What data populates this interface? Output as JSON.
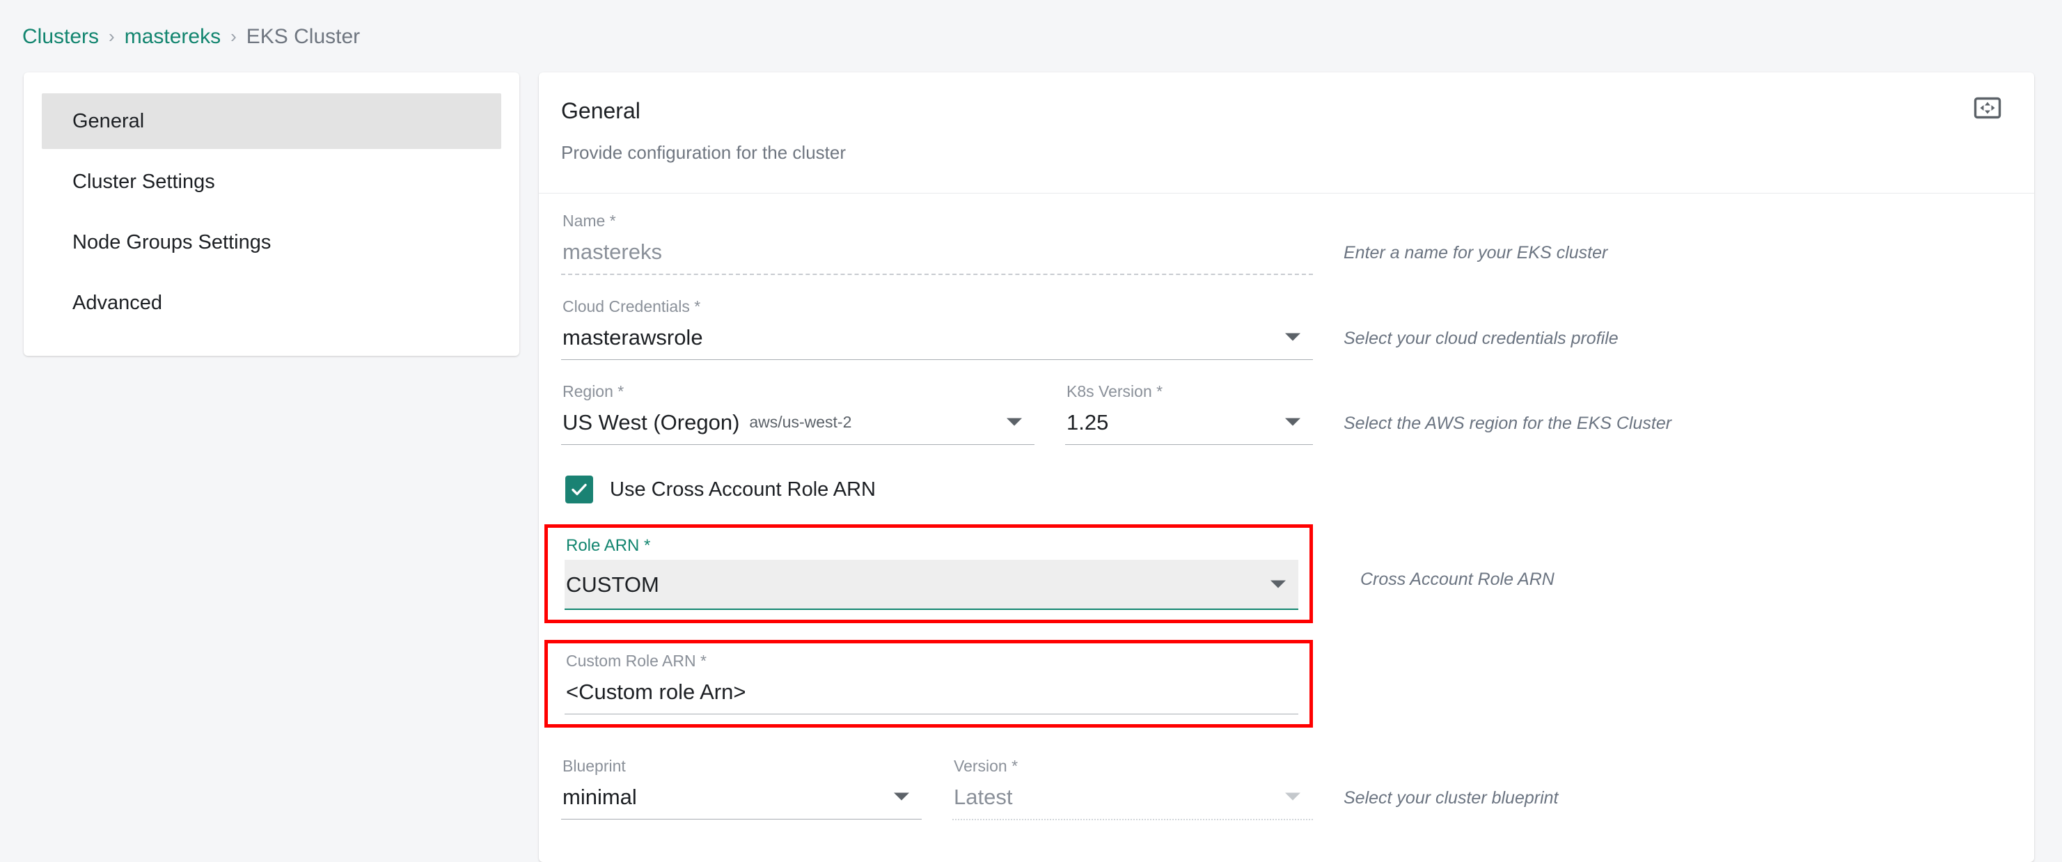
{
  "breadcrumb": {
    "items": [
      {
        "label": "Clusters",
        "type": "link"
      },
      {
        "label": "mastereks",
        "type": "link"
      },
      {
        "label": "EKS Cluster",
        "type": "current"
      }
    ],
    "separator": "›"
  },
  "sidebar": {
    "items": [
      {
        "label": "General",
        "active": true
      },
      {
        "label": "Cluster Settings",
        "active": false
      },
      {
        "label": "Node Groups Settings",
        "active": false
      },
      {
        "label": "Advanced",
        "active": false
      }
    ]
  },
  "main": {
    "title": "General",
    "subtitle": "Provide configuration for the cluster",
    "expand_icon": "expand-arrows-icon"
  },
  "form": {
    "name": {
      "label": "Name *",
      "value": "mastereks",
      "help": "Enter a name for your EKS cluster"
    },
    "cloud_credentials": {
      "label": "Cloud Credentials *",
      "value": "masterawsrole",
      "help": "Select your cloud credentials profile"
    },
    "region": {
      "label": "Region *",
      "value": "US West (Oregon)",
      "value_sub": "aws/us-west-2",
      "help": "Select the AWS region for the EKS Cluster"
    },
    "k8s_version": {
      "label": "K8s Version *",
      "value": "1.25"
    },
    "cross_account": {
      "label": "Use Cross Account Role ARN",
      "checked": true,
      "check_glyph": "✓"
    },
    "role_arn": {
      "label": "Role ARN *",
      "value": "CUSTOM",
      "help": "Cross Account Role ARN",
      "highlighted": true
    },
    "custom_role_arn": {
      "label": "Custom Role ARN *",
      "value": "<Custom role Arn>",
      "highlighted": true
    },
    "blueprint": {
      "label": "Blueprint",
      "value": "minimal",
      "help": "Select your cluster blueprint"
    },
    "version": {
      "label": "Version *",
      "value": "Latest"
    }
  },
  "colors": {
    "accent_teal": "#12856f",
    "checkbox_green": "#1a8273",
    "highlight_red": "#ff0000",
    "page_bg": "#f5f6f8",
    "sidebar_active_bg": "#e3e3e3"
  }
}
